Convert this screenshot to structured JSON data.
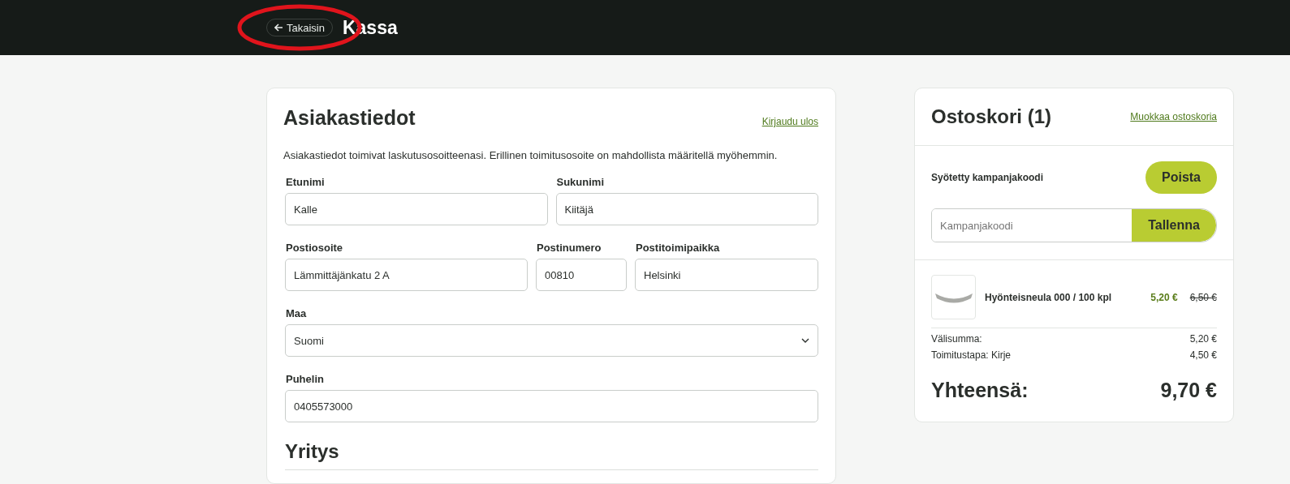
{
  "header": {
    "back_button": "Takaisin",
    "title": "Kassa"
  },
  "customer": {
    "title": "Asiakastiedot",
    "logout_link": "Kirjaudu ulos",
    "intro": "Asiakastiedot toimivat laskutusosoitteenasi. Erillinen toimitusosoite on mahdollista määritellä myöhemmin.",
    "rows": [
      [
        {
          "label": "Etunimi",
          "value": "Kalle",
          "kind": "input"
        },
        {
          "label": "Sukunimi",
          "value": "Kiitäjä",
          "kind": "input"
        }
      ],
      [
        {
          "label": "Postiosoite",
          "value": "Lämmittäjänkatu 2 A",
          "kind": "input"
        },
        {
          "label": "Postinumero",
          "value": "00810",
          "kind": "input"
        },
        {
          "label": "Postitoimipaikka",
          "value": "Helsinki",
          "kind": "input"
        }
      ],
      [
        {
          "label": "Maa",
          "value": "Suomi",
          "kind": "select"
        }
      ],
      [
        {
          "label": "Puhelin",
          "value": "0405573000",
          "kind": "input"
        }
      ]
    ],
    "section_title": "Yritys"
  },
  "cart": {
    "title": "Ostoskori (1)",
    "edit_link": "Muokkaa ostoskoria",
    "coupon_label": "Syötetty kampanjakoodi",
    "remove_button": "Poista",
    "coupon_field": {
      "placeholder": "Kampanjakoodi"
    },
    "save_button": "Tallenna",
    "items": [
      {
        "name": "Hyönteisneula 000 / 100 kpl",
        "price": "5,20 €",
        "old_price": "6,50 €"
      }
    ],
    "lines": [
      {
        "label": "Välisumma:",
        "value": "5,20 €"
      },
      {
        "label": "Toimitustapa: Kirje",
        "value": "4,50 €"
      }
    ],
    "total": {
      "label": "Yhteensä:",
      "value": "9,70 €"
    }
  }
}
